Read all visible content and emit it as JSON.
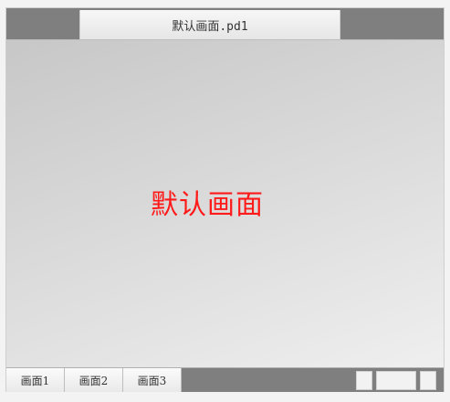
{
  "window": {
    "title": "默认画面.pd1"
  },
  "canvas": {
    "text": "默认画面",
    "text_color": "#ff1a1a"
  },
  "bottom_tabs": [
    {
      "label": "画面1"
    },
    {
      "label": "画面2"
    },
    {
      "label": "画面3"
    }
  ],
  "colors": {
    "bar_gray": "#7f7f7f",
    "tab_light": "#f2f2f2"
  }
}
